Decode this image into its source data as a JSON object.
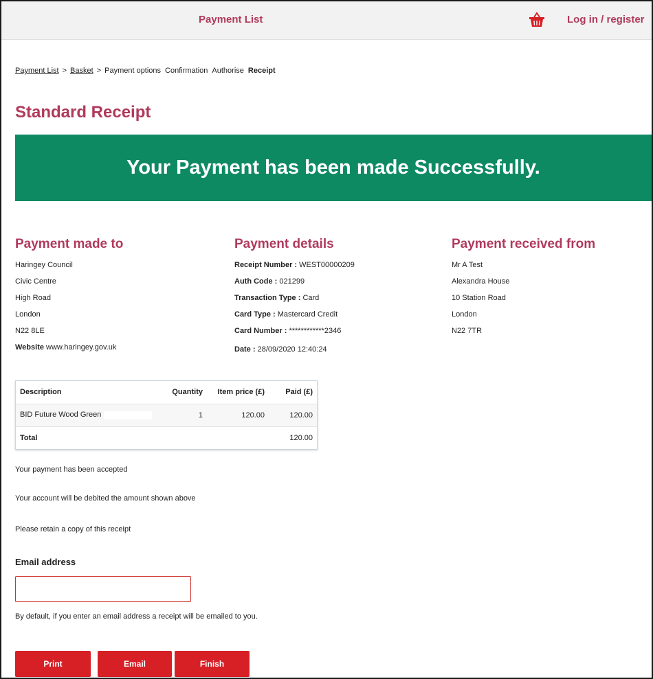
{
  "header": {
    "title": "Payment List",
    "login_label": "Log in / register",
    "basket_icon": "basket-icon",
    "accent": "#b03a5b"
  },
  "breadcrumb": {
    "items": [
      {
        "label": "Payment List",
        "link": true
      },
      {
        "label": "Basket",
        "link": true
      },
      {
        "label": "Payment options",
        "link": false
      },
      {
        "label": "Confirmation",
        "link": false
      },
      {
        "label": "Authorise",
        "link": false
      },
      {
        "label": "Receipt",
        "link": false,
        "current": true
      }
    ],
    "separator": ">"
  },
  "page_title": "Standard Receipt",
  "banner": {
    "text": "Your Payment has been made Successfully.",
    "color": "#0e8a63"
  },
  "payment_made_to": {
    "heading": "Payment made to",
    "lines": [
      "Haringey Council",
      "Civic Centre",
      "High Road",
      "London",
      "N22 8LE"
    ],
    "website_label": "Website",
    "website": "www.haringey.gov.uk"
  },
  "payment_details": {
    "heading": "Payment details",
    "fields": [
      {
        "label": "Receipt Number :",
        "value": "WEST00000209"
      },
      {
        "label": "Auth Code :",
        "value": "021299"
      },
      {
        "label": "Transaction Type :",
        "value": "Card"
      },
      {
        "label": "Card Type :",
        "value": "Mastercard Credit"
      },
      {
        "label": "Card Number :",
        "value": "************2346"
      },
      {
        "label": "Date :",
        "value": "28/09/2020 12:40:24"
      }
    ]
  },
  "payment_received_from": {
    "heading": "Payment received from",
    "lines": [
      "Mr A Test",
      "Alexandra House",
      "10 Station Road",
      "London",
      "N22 7TR"
    ]
  },
  "table": {
    "headers": [
      "Description",
      "Quantity",
      "Item price (£)",
      "Paid (£)"
    ],
    "rows": [
      {
        "description": "BID Future Wood Green",
        "quantity": "1",
        "item_price": "120.00",
        "paid": "120.00"
      }
    ],
    "total_label": "Total",
    "total_paid": "120.00"
  },
  "messages": [
    "Your payment has been accepted",
    "Your account will be debited the amount shown above",
    "Please retain a copy of this receipt"
  ],
  "email": {
    "label": "Email address",
    "value": "",
    "hint": "By default, if you enter an email address a receipt will be emailed to you."
  },
  "buttons": {
    "print": "Print",
    "email": "Email",
    "finish": "Finish",
    "color": "#d71f26"
  }
}
